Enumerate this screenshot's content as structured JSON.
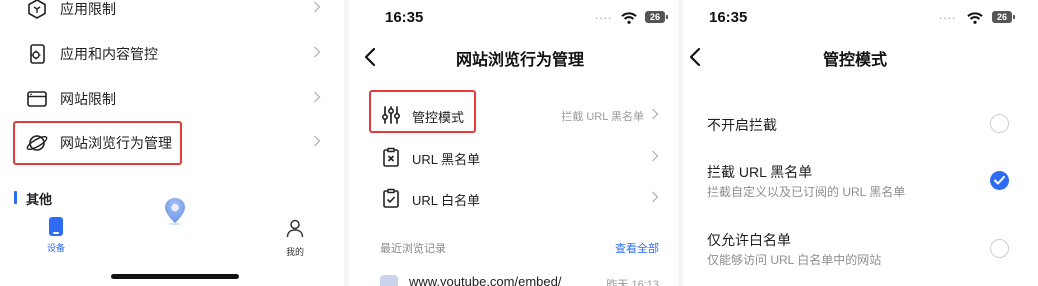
{
  "panel1": {
    "items": [
      {
        "label": "应用限制",
        "icon": "app-restrict-icon"
      },
      {
        "label": "应用和内容管控",
        "icon": "content-control-icon"
      },
      {
        "label": "网站限制",
        "icon": "website-restrict-icon"
      },
      {
        "label": "网站浏览行为管理",
        "icon": "planet-icon"
      }
    ],
    "section": "其他",
    "tabbar": {
      "devices": "设备",
      "mine": "我的"
    },
    "highlight_color": "#e43a3a"
  },
  "panel2": {
    "status": {
      "time": "16:35",
      "battery": "26"
    },
    "title": "网站浏览行为管理",
    "items": [
      {
        "label": "管控模式",
        "value": "拦截 URL 黑名单",
        "icon": "sliders-icon"
      },
      {
        "label": "URL 黑名单",
        "value": "",
        "icon": "blacklist-icon"
      },
      {
        "label": "URL 白名单",
        "value": "",
        "icon": "whitelist-icon"
      }
    ],
    "recent_label": "最近浏览记录",
    "view_all": "查看全部",
    "history": [
      {
        "url": "www.youtube.com/embed/",
        "time": "昨天 16:13"
      }
    ]
  },
  "panel3": {
    "status": {
      "time": "16:35",
      "battery": "26"
    },
    "title": "管控模式",
    "options": [
      {
        "label": "不开启拦截",
        "desc": "",
        "selected": false
      },
      {
        "label": "拦截 URL 黑名单",
        "desc": "拦截自定义以及已订阅的 URL 黑名单",
        "selected": true
      },
      {
        "label": "仅允许白名单",
        "desc": "仅能够访问 URL 白名单中的网站",
        "selected": false
      }
    ],
    "accent_color": "#2f6cf6"
  }
}
